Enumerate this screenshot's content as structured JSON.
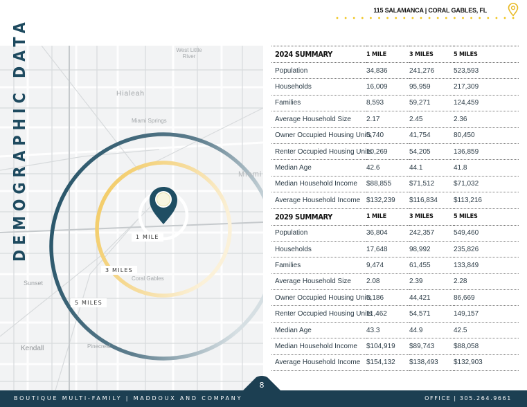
{
  "header": {
    "property_title": "115 SALAMANCA | CORAL GABLES, FL",
    "pin_icon": "map-pin-icon"
  },
  "section_title": "DEMOGRAPHIC DATA",
  "map": {
    "place_labels": [
      "West Little River",
      "Hialeah",
      "Miami Springs",
      "Miami",
      "Coral Gables",
      "Sunset",
      "Kendall",
      "Pinecrest"
    ],
    "radius_labels": {
      "one_mile": "1 MILE",
      "three_miles": "3 MILES",
      "five_miles": "5 MILES"
    },
    "ring_colors": {
      "inner": "#ffffff",
      "middle": "#f3cf78",
      "outer": "#1f4e63"
    }
  },
  "tables": [
    {
      "title": "2024 SUMMARY",
      "columns": [
        "1 MILE",
        "3 MILES",
        "5 MILES"
      ],
      "rows": [
        {
          "label": "Population",
          "values": [
            "34,836",
            "241,276",
            "523,593"
          ]
        },
        {
          "label": "Households",
          "values": [
            "16,009",
            "95,959",
            "217,309"
          ]
        },
        {
          "label": "Families",
          "values": [
            "8,593",
            "59,271",
            "124,459"
          ]
        },
        {
          "label": "Average Household Size",
          "values": [
            "2.17",
            "2.45",
            "2.36"
          ]
        },
        {
          "label": "Owner Occupied Housing Units",
          "values": [
            "5,740",
            "41,754",
            "80,450"
          ]
        },
        {
          "label": "Renter Occupied Housing Units",
          "values": [
            "10,269",
            "54,205",
            "136,859"
          ]
        },
        {
          "label": "Median Age",
          "values": [
            "42.6",
            "44.1",
            "41.8"
          ]
        },
        {
          "label": "Median Household Income",
          "values": [
            "$88,855",
            "$71,512",
            "$71,032"
          ]
        },
        {
          "label": "Average Household Income",
          "values": [
            "$132,239",
            "$116,834",
            "$113,216"
          ]
        }
      ]
    },
    {
      "title": "2029 SUMMARY",
      "columns": [
        "1 MILE",
        "3 MILES",
        "5 MILES"
      ],
      "rows": [
        {
          "label": "Population",
          "values": [
            "36,804",
            "242,357",
            "549,460"
          ]
        },
        {
          "label": "Households",
          "values": [
            "17,648",
            "98,992",
            "235,826"
          ]
        },
        {
          "label": "Families",
          "values": [
            "9,474",
            "61,455",
            "133,849"
          ]
        },
        {
          "label": "Average Household Size",
          "values": [
            "2.08",
            "2.39",
            "2.28"
          ]
        },
        {
          "label": "Owner Occupied Housing Units",
          "values": [
            "6,186",
            "44,421",
            "86,669"
          ]
        },
        {
          "label": "Renter Occupied Housing Units",
          "values": [
            "11,462",
            "54,571",
            "149,157"
          ]
        },
        {
          "label": "Median Age",
          "values": [
            "43.3",
            "44.9",
            "42.5"
          ]
        },
        {
          "label": "Median Household Income",
          "values": [
            "$104,919",
            "$89,743",
            "$88,058"
          ]
        },
        {
          "label": "Average Household Income",
          "values": [
            "$154,132",
            "$138,493",
            "$132,903"
          ]
        }
      ]
    }
  ],
  "footer": {
    "left_text": "BOUTIQUE MULTI-FAMILY | MADDOUX AND COMPANY",
    "page_number": "8",
    "right_text": "OFFICE | 305.264.9661"
  },
  "colors": {
    "brand_navy": "#1c3f52",
    "accent_gold": "#f0c419"
  }
}
